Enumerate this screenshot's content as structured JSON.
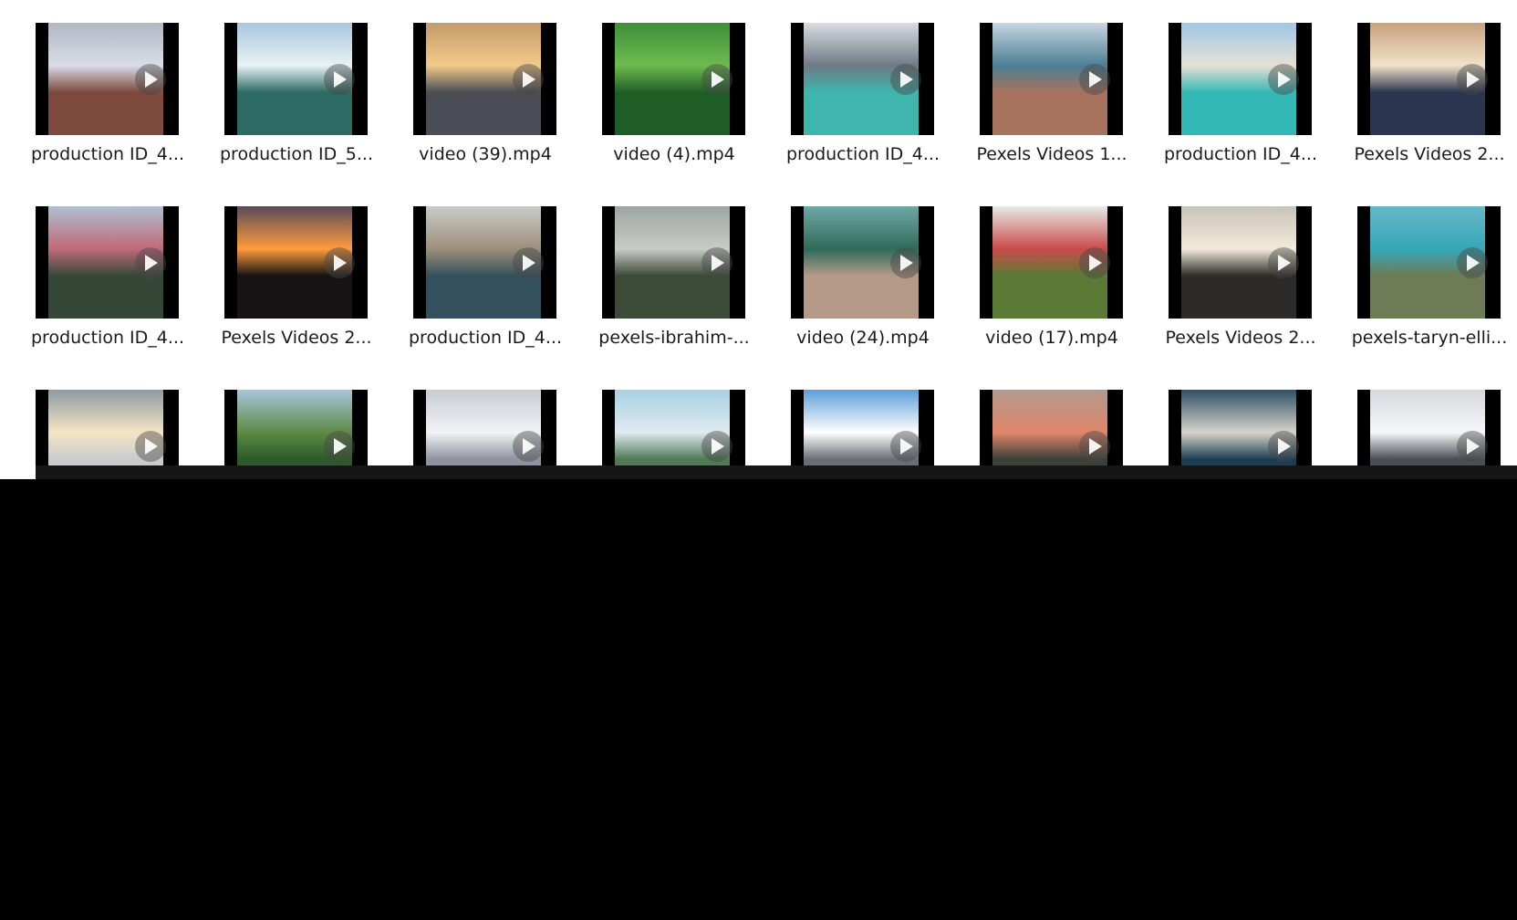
{
  "files": [
    {
      "name": "production ID_4...",
      "thumb": "city-aerial",
      "sky": "#b3b7c4",
      "ground": "#7d4a3d",
      "accent": "#d8dce6"
    },
    {
      "name": "production ID_5...",
      "thumb": "ocean-shore",
      "sky": "#a9c7dc",
      "ground": "#2d6a63",
      "accent": "#e8f2f4"
    },
    {
      "name": "video (39).mp4",
      "thumb": "sunset-tower",
      "sky": "#c39a6a",
      "ground": "#4a4d55",
      "accent": "#f3c98a"
    },
    {
      "name": "video (4).mp4",
      "thumb": "green-forest",
      "sky": "#3f8f3a",
      "ground": "#1f5d27",
      "accent": "#6dbb4f"
    },
    {
      "name": "production ID_4...",
      "thumb": "beach-hotels",
      "sky": "#d9dde2",
      "ground": "#3fb6ad",
      "accent": "#6f7a85"
    },
    {
      "name": "Pexels Videos 1...",
      "thumb": "coastal-road",
      "sky": "#c8d6e2",
      "ground": "#a7735e",
      "accent": "#4c7f95"
    },
    {
      "name": "production ID_4...",
      "thumb": "resort-beach",
      "sky": "#9fc7e6",
      "ground": "#34b8b6",
      "accent": "#e7e0d3"
    },
    {
      "name": "Pexels Videos 2...",
      "thumb": "bridge",
      "sky": "#c7a27f",
      "ground": "#2b3550",
      "accent": "#f1e2c9"
    },
    {
      "name": "production ID_4...",
      "thumb": "town-trees",
      "sky": "#aebfcf",
      "ground": "#354838",
      "accent": "#c06a7b"
    },
    {
      "name": "Pexels Videos 2...",
      "thumb": "sunset-sea",
      "sky": "#5a4a59",
      "ground": "#151313",
      "accent": "#ff9b3d"
    },
    {
      "name": "production ID_4...",
      "thumb": "lake-pier",
      "sky": "#c9cbc8",
      "ground": "#34505d",
      "accent": "#9c8f7a"
    },
    {
      "name": "pexels-ibrahim-...",
      "thumb": "misty-hills",
      "sky": "#9ea5a2",
      "ground": "#3c4a38",
      "accent": "#c9ccc8"
    },
    {
      "name": "video (24).mp4",
      "thumb": "rock-peaks",
      "sky": "#6fa8a6",
      "ground": "#b49a86",
      "accent": "#2f6b5a"
    },
    {
      "name": "video (17).mp4",
      "thumb": "autumn-forest",
      "sky": "#e7ebe8",
      "ground": "#5b7a35",
      "accent": "#c94b4b"
    },
    {
      "name": "Pexels Videos 2...",
      "thumb": "foggy-sun",
      "sky": "#c8c3bb",
      "ground": "#2d2b28",
      "accent": "#f2ead9"
    },
    {
      "name": "pexels-taryn-elli...",
      "thumb": "coast-town",
      "sky": "#67b9c8",
      "ground": "#6d7b56",
      "accent": "#36a7b8"
    },
    {
      "name": "",
      "thumb": "cloud-sea",
      "sky": "#8e9aa3",
      "ground": "#c9cccd",
      "accent": "#f5e4c3"
    },
    {
      "name": "",
      "thumb": "jungle-ridge",
      "sky": "#a9c6dd",
      "ground": "#2d5a2b",
      "accent": "#5d8a45"
    },
    {
      "name": "",
      "thumb": "snow-trees-top",
      "sky": "#c7cbd2",
      "ground": "#8d93a0",
      "accent": "#f2f3f6"
    },
    {
      "name": "",
      "thumb": "lake-mountain",
      "sky": "#a7d0e4",
      "ground": "#4f7a56",
      "accent": "#dfeaf0"
    },
    {
      "name": "",
      "thumb": "city-clouds",
      "sky": "#5d9fd8",
      "ground": "#6a6f77",
      "accent": "#ffffff"
    },
    {
      "name": "",
      "thumb": "hazy-sunset",
      "sky": "#b29a8e",
      "ground": "#3c4038",
      "accent": "#e0856a"
    },
    {
      "name": "",
      "thumb": "harbor",
      "sky": "#2e4f66",
      "ground": "#1b3e52",
      "accent": "#d8d4cb"
    },
    {
      "name": "",
      "thumb": "snow-forest",
      "sky": "#d4d7dc",
      "ground": "#4a4e55",
      "accent": "#f6f7f9"
    }
  ]
}
